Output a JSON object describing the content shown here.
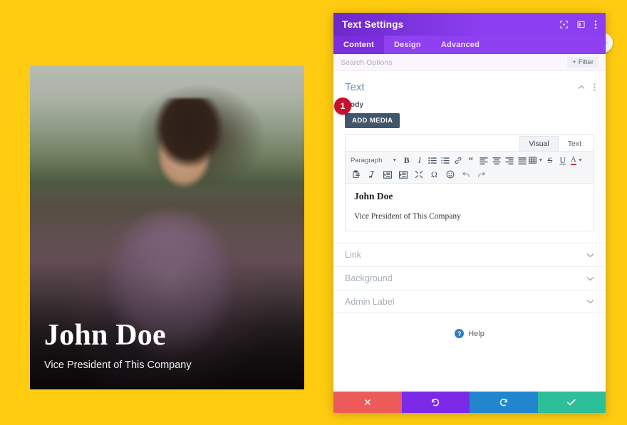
{
  "canvas": {
    "background_color": "#ffcc11"
  },
  "preview": {
    "name": "John Doe",
    "role": "Vice President of This Company"
  },
  "panel": {
    "title": "Text Settings",
    "accent_color": "#8b3ff0",
    "header_icons": [
      {
        "name": "expand-icon"
      },
      {
        "name": "panel-layout-icon"
      },
      {
        "name": "more-vertical-icon"
      }
    ],
    "tabs": [
      {
        "label": "Content",
        "active": true
      },
      {
        "label": "Design",
        "active": false
      },
      {
        "label": "Advanced",
        "active": false
      }
    ],
    "search": {
      "placeholder": "Search Options",
      "value": "",
      "filter_label": "Filter",
      "filter_icon": "plus-icon"
    },
    "section": {
      "title": "Text",
      "collapse_icon": "chevron-up-icon",
      "menu_icon": "more-vertical-icon",
      "field_label": "Body",
      "add_media_label": "ADD MEDIA"
    },
    "editor": {
      "mode_tabs": [
        {
          "label": "Visual",
          "active": true
        },
        {
          "label": "Text",
          "active": false
        }
      ],
      "format_select": "Paragraph",
      "toolbar_row1": [
        "bold-icon",
        "italic-icon",
        "bulleted-list-icon",
        "numbered-list-icon",
        "link-icon",
        "blockquote-icon",
        "align-left-icon",
        "align-center-icon",
        "align-right-icon",
        "align-justify-icon",
        "table-icon",
        "strikethrough-icon",
        "underline-icon",
        "text-color-icon"
      ],
      "toolbar_row2": [
        "paste-as-text-icon",
        "clear-formatting-icon",
        "outdent-icon",
        "indent-icon",
        "fullscreen-icon",
        "special-character-icon",
        "emoji-icon",
        "undo-icon",
        "redo-icon"
      ],
      "content_heading": "John Doe",
      "content_paragraph": "Vice President of This Company"
    },
    "step_badge": "1",
    "accordion": [
      {
        "label": "Link",
        "chevron": "chevron-down-icon"
      },
      {
        "label": "Background",
        "chevron": "chevron-down-icon"
      },
      {
        "label": "Admin Label",
        "chevron": "chevron-down-icon"
      }
    ],
    "help": {
      "label": "Help",
      "icon": "question-circle-icon"
    },
    "footer_buttons": [
      {
        "name": "cancel-button",
        "icon": "close-icon",
        "color": "#ed5a5a"
      },
      {
        "name": "undo-button",
        "icon": "undo-icon",
        "color": "#7c2ae8"
      },
      {
        "name": "redo-button",
        "icon": "redo-icon",
        "color": "#2185d0"
      },
      {
        "name": "save-button",
        "icon": "check-icon",
        "color": "#2dbe9a"
      }
    ]
  },
  "floating_button": {
    "name": "settings-round-button",
    "icon": "gear-icon"
  }
}
